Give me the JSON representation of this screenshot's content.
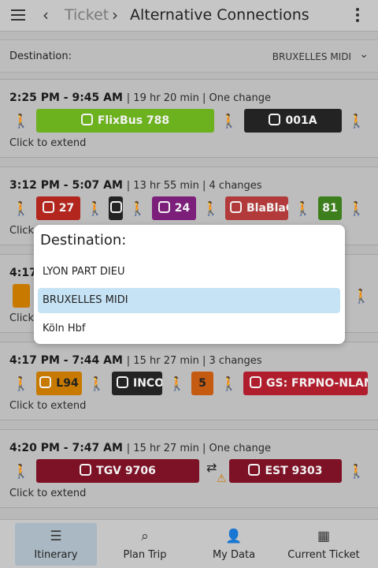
{
  "header": {
    "breadcrumb_parent": "Ticket",
    "title": "Alternative Connections"
  },
  "destination": {
    "label": "Destination:",
    "value": "BRUXELLES MIDI"
  },
  "connections": [
    {
      "times": "2:25 PM - 9:45 AM",
      "meta": "| 19 hr 20 min | One change",
      "extend": "Click to extend",
      "legs": [
        {
          "label": "FlixBus 788",
          "color": "#6cb21f",
          "icon": "bus-icon"
        },
        {
          "label": "001A",
          "color": "#232323",
          "icon": "tram-icon"
        }
      ]
    },
    {
      "times": "3:12 PM - 5:07 AM",
      "meta": "| 13 hr 55 min | 4 changes",
      "extend": "Click to extend",
      "legs": [
        {
          "label": "27",
          "color": "#b3261e",
          "icon": "bus-icon"
        },
        {
          "label": "",
          "color": "#232323",
          "icon": "tram-icon"
        },
        {
          "label": "24",
          "color": "#7b1f7b",
          "icon": "bus-icon"
        },
        {
          "label": "BlaBlaCar",
          "color": "#b23a3a",
          "icon": "bus-icon"
        },
        {
          "label": "81",
          "color": "#3d7f1d",
          "icon": "bus-icon"
        }
      ]
    },
    {
      "times": "4:17 PM - 7:44 AM",
      "meta": "",
      "extend": "Click to extend",
      "legs": []
    },
    {
      "times": "4:17 PM - 7:44 AM",
      "meta": "| 15 hr 27 min | 3 changes",
      "extend": "Click to extend",
      "legs": [
        {
          "label": "L94",
          "color": "#c87a00",
          "icon": "bus-icon"
        },
        {
          "label": "INCO",
          "color": "#232323",
          "icon": "tram-icon"
        },
        {
          "label": "5",
          "color": "#c55a11",
          "icon": ""
        },
        {
          "label": "GS: FRPNO-NLAMA",
          "color": "#b01e2e",
          "icon": "train-icon"
        }
      ]
    },
    {
      "times": "4:20 PM - 7:47 AM",
      "meta": "| 15 hr 27 min | One change",
      "extend": "Click to extend",
      "legs": [
        {
          "label": "TGV 9706",
          "color": "#7d1226",
          "icon": "highspeed-train-icon"
        },
        {
          "label": "EST 9303",
          "color": "#7d1226",
          "icon": "highspeed-train-icon"
        }
      ]
    }
  ],
  "popup": {
    "title": "Destination:",
    "options": [
      "LYON PART DIEU",
      "BRUXELLES MIDI",
      "Köln Hbf"
    ],
    "selected": "BRUXELLES MIDI"
  },
  "bottom_nav": [
    {
      "label": "Itinerary",
      "icon": "itinerary-icon",
      "active": true
    },
    {
      "label": "Plan Trip",
      "icon": "search-icon",
      "active": false
    },
    {
      "label": "My Data",
      "icon": "user-icon",
      "active": false
    },
    {
      "label": "Current Ticket",
      "icon": "qr-code-icon",
      "active": false
    }
  ],
  "colors": {
    "accent_selected": "#c6e3f5",
    "nav_active": "#a9b8c2",
    "warning": "#c9760a"
  }
}
